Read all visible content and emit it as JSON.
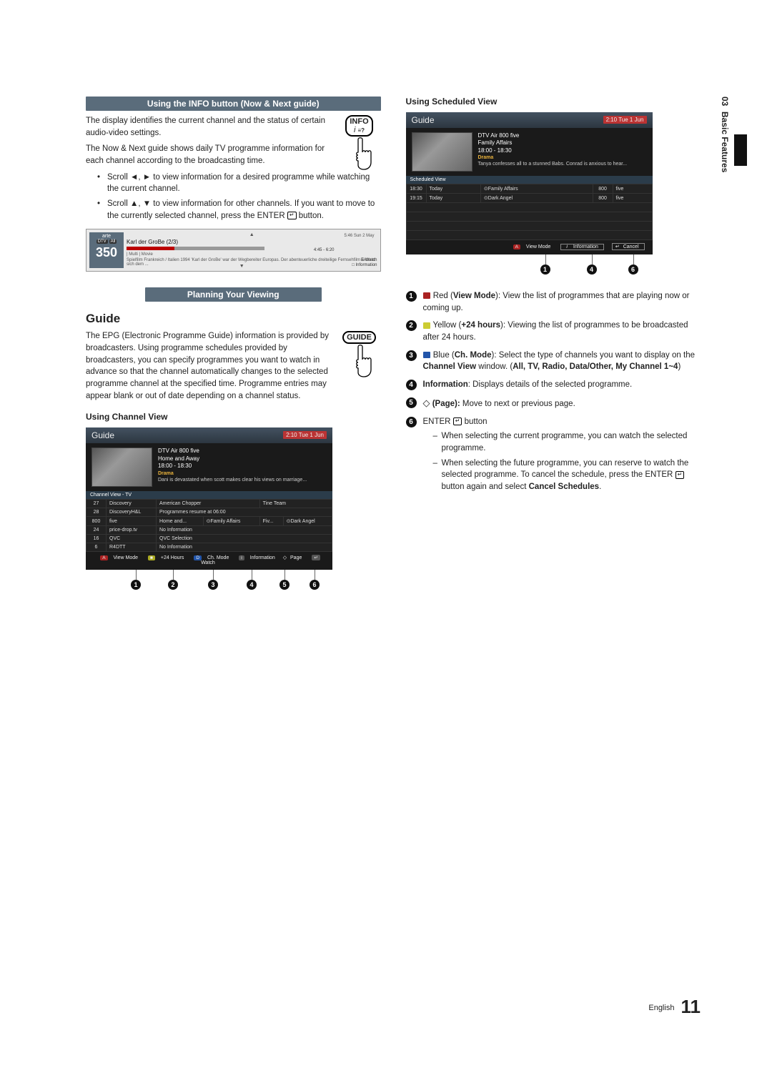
{
  "sideTab": {
    "num": "03",
    "label": "Basic Features"
  },
  "col1": {
    "sec1_title": "Using the INFO button (Now & Next guide)",
    "infoBtn": "INFO",
    "p1": "The display identifies the current channel and the status of certain audio-video settings.",
    "p2": "The Now & Next guide shows daily TV programme information for each channel according to the broadcasting time.",
    "b1a": "Scroll ◄, ► to view information for a desired programme while watching the current channel.",
    "b1b": "Scroll ▲, ▼ to view information for other channels. If you want to move to the currently selected channel, press the ENTER",
    "b1b_tail": " button.",
    "infoPanel": {
      "chName": "arte",
      "chTag1": "DTV",
      "chTag2": "All",
      "chNum": "350",
      "clock": "5:46 Sun 2 May",
      "title": "Karl der GroBe (2/3)",
      "meta": "| Multi | Movie",
      "time": "4:45 - 6:20",
      "desc": "Spielfilm Frankreich / Italien 1994 'Karl der GroBe' war der Wegbereiter Europas. Der abenteuerliche dreiteilige Fernsehfilm widmet sich dem ...",
      "tag1": "E Watch",
      "tag2": "□ Information"
    },
    "sec2_title": "Planning Your Viewing",
    "guide_h": "Guide",
    "guideBtn": "GUIDE",
    "guide_p": "The EPG (Electronic Programme Guide) information is provided by broadcasters. Using programme schedules provided by broadcasters, you can specify programmes you want to watch in advance so that the channel automatically changes to the selected programme channel at the specified time. Programme entries may appear blank or out of date depending on a channel status.",
    "sub_channel": "Using  Channel View",
    "cv": {
      "title": "Guide",
      "clock": "2:10 Tue 1 Jun",
      "ch": "DTV Air 800 five",
      "prog": "Home and Away",
      "time": "18:00 - 18:30",
      "genre": "Drama",
      "syn": "Dani is devastated when scott makes clear his views on marriage...",
      "sub": "Channel View - TV",
      "rows": [
        {
          "n": "27",
          "nm": "Discovery",
          "c1": "American Chopper",
          "c2": "Tine Team"
        },
        {
          "n": "28",
          "nm": "DiscoveryH&L",
          "c1": "Programmes resume at 06:00",
          "c2": ""
        },
        {
          "n": "800",
          "nm": "five",
          "c1": "Home and...",
          "c2": "⊙Family Affairs",
          "c3": "Fiv...",
          "c4": "⊙Dark Angel"
        },
        {
          "n": "24",
          "nm": "price-drop.tv",
          "c1": "No Information",
          "c2": ""
        },
        {
          "n": "16",
          "nm": "QVC",
          "c1": "QVC Selection",
          "c2": ""
        },
        {
          "n": "6",
          "nm": "R4DTT",
          "c1": "No Information",
          "c2": ""
        }
      ],
      "foot": {
        "a": "View Mode",
        "b": "+24 Hours",
        "c": "Ch. Mode",
        "d": "Information",
        "e": "Page",
        "f": "Watch"
      }
    }
  },
  "col2": {
    "sub_sched": "Using Scheduled View",
    "sv": {
      "title": "Guide",
      "clock": "2:10 Tue 1 Jun",
      "ch": "DTV Air 800 five",
      "prog": "Family Affairs",
      "time": "18:00 - 18:30",
      "genre": "Drama",
      "syn": "Tanya confesses all to a stunned Babs. Conrad is anxious to hear...",
      "sub": "Scheduled View",
      "rows": [
        {
          "t": "18:30",
          "d": "Today",
          "p": "⊙Family Affairs",
          "n": "800",
          "c": "five"
        },
        {
          "t": "19:15",
          "d": "Today",
          "p": "⊙Dark Angel",
          "n": "800",
          "c": "five"
        }
      ],
      "foot": {
        "a": "View Mode",
        "b": "Information",
        "c": "Cancel"
      }
    },
    "list": {
      "i1a": "Red (",
      "i1b": "View Mode",
      "i1c": "): View the list of programmes that are playing now or coming up.",
      "i2a": "Yellow (",
      "i2b": "+24 hours",
      "i2c": "): Viewing the list of programmes to be broadcasted after 24 hours.",
      "i3a": "Blue (",
      "i3b": "Ch. Mode",
      "i3c": "): Select the type of channels you want to display on the ",
      "i3d": "Channel View",
      "i3e": " window. (",
      "i3f": "All, TV, Radio, Data/Other, My Channel 1~4",
      "i3g": ")",
      "i4a": "Information",
      "i4b": ": Displays details of the selected programme.",
      "i5a": "(Page):",
      "i5b": " Move to next or previous page.",
      "i6a": "ENTER",
      "i6b": " button",
      "s1": "When selecting the current programme, you can watch the selected programme.",
      "s2a": "When selecting the future programme, you can reserve to watch the selected programme. To cancel the schedule, press the ENTER",
      "s2b": " button again and select ",
      "s2c": "Cancel Schedules",
      "s2d": "."
    }
  },
  "footer": {
    "lang": "English",
    "page": "11"
  }
}
